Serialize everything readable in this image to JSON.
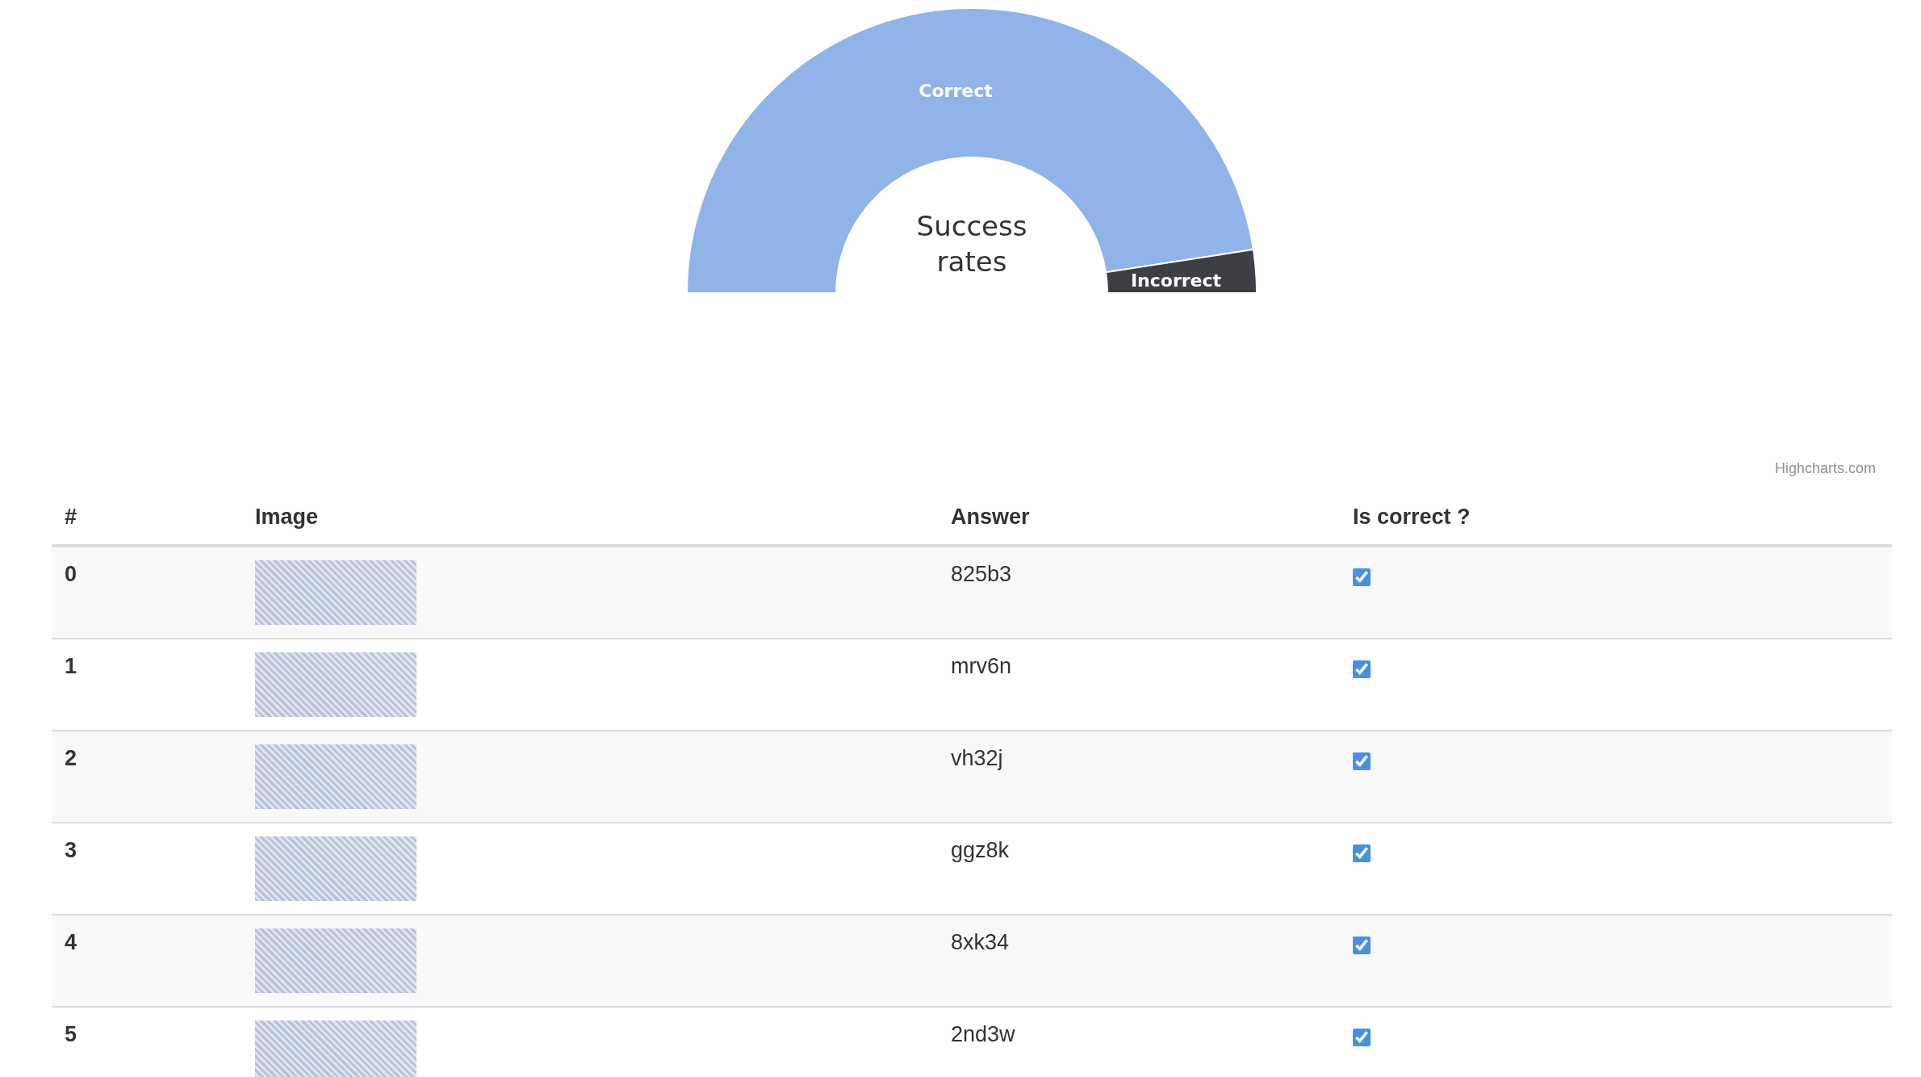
{
  "chart": {
    "title": "Success rates",
    "slices": [
      {
        "label": "Correct",
        "color": "#90b4e8"
      },
      {
        "label": "Incorrect",
        "color": "#3e3e45"
      }
    ],
    "credit": "Highcharts.com"
  },
  "table": {
    "columns": [
      "#",
      "Image",
      "Answer",
      "Is correct ?"
    ],
    "rows": [
      {
        "index": "0",
        "answer": "825b3",
        "checked": true
      },
      {
        "index": "1",
        "answer": "mrv6n",
        "checked": true
      },
      {
        "index": "2",
        "answer": "vh32j",
        "checked": true
      },
      {
        "index": "3",
        "answer": "ggz8k",
        "checked": true
      },
      {
        "index": "4",
        "answer": "8xk34",
        "checked": true
      },
      {
        "index": "5",
        "answer": "2nd3w",
        "checked": true
      }
    ]
  }
}
